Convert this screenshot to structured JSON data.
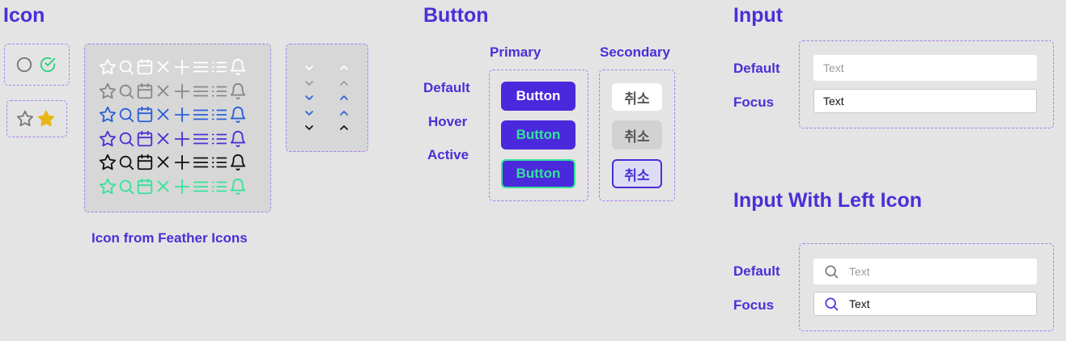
{
  "sections": {
    "icon": "Icon",
    "button": "Button",
    "input": "Input",
    "input_with_left_icon": "Input With Left Icon"
  },
  "icon_caption": "Icon from Feather Icons",
  "icon_grid": {
    "icons": [
      "star-icon",
      "search-icon",
      "calendar-icon",
      "close-icon",
      "plus-icon",
      "menu-icon",
      "list-icon",
      "bell-icon"
    ],
    "row_colors": [
      "#ffffff",
      "#888888",
      "#2860d8",
      "#4b2fd6",
      "#111111",
      "#33e49a"
    ]
  },
  "chevron_colors": [
    "#ffffff",
    "#999999",
    "#2860d8",
    "#2860d8",
    "#111111"
  ],
  "small_icons": {
    "circle_color": "#777777",
    "check_color": "#2fcf7e",
    "star_outline_color": "#777777",
    "star_filled_color": "#e6b716"
  },
  "button": {
    "primary_header": "Primary",
    "secondary_header": "Secondary",
    "states": [
      "Default",
      "Hover",
      "Active"
    ],
    "primary_label": "Button",
    "secondary_label": "취소",
    "primary_colors": {
      "bg": "#4a28dc",
      "text_default": "#ffffff",
      "text_hover": "#33e49a",
      "active_border": "#33e49a"
    },
    "secondary_colors": {
      "bg_default": "#ffffff",
      "bg_hover": "#d2d2d2",
      "text": "#555555",
      "active_border": "#4b2fd6",
      "active_text": "#4b2fd6"
    }
  },
  "input": {
    "default_label": "Default",
    "focus_label": "Focus",
    "default_placeholder": "Text",
    "focus_value": "Text"
  },
  "input_icon": {
    "default_label": "Default",
    "focus_label": "Focus",
    "default_placeholder": "Text",
    "focus_value": "Text",
    "default_icon_color": "#777777",
    "focus_icon_color": "#4b2fd6"
  }
}
